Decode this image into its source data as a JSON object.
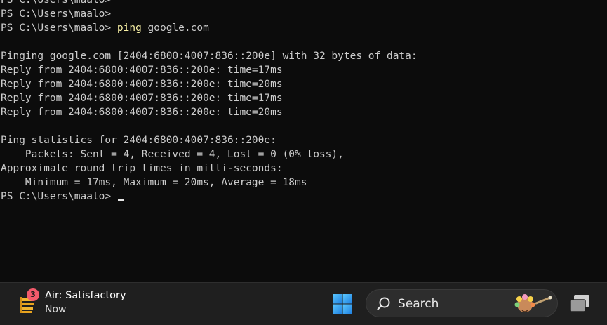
{
  "terminal": {
    "lines": [
      {
        "text": "PS C:\\Users\\maalo>",
        "cmd": ""
      },
      {
        "text": "PS C:\\Users\\maalo>",
        "cmd": ""
      },
      {
        "text": "PS C:\\Users\\maalo> ",
        "cmd": "ping",
        "arg": " google.com"
      },
      {
        "text": "",
        "cmd": ""
      },
      {
        "text": "Pinging google.com [2404:6800:4007:836::200e] with 32 bytes of data:",
        "cmd": ""
      },
      {
        "text": "Reply from 2404:6800:4007:836::200e: time=17ms",
        "cmd": ""
      },
      {
        "text": "Reply from 2404:6800:4007:836::200e: time=20ms",
        "cmd": ""
      },
      {
        "text": "Reply from 2404:6800:4007:836::200e: time=17ms",
        "cmd": ""
      },
      {
        "text": "Reply from 2404:6800:4007:836::200e: time=20ms",
        "cmd": ""
      },
      {
        "text": "",
        "cmd": ""
      },
      {
        "text": "Ping statistics for 2404:6800:4007:836::200e:",
        "cmd": ""
      },
      {
        "text": "    Packets: Sent = 4, Received = 4, Lost = 0 (0% loss),",
        "cmd": ""
      },
      {
        "text": "Approximate round trip times in milli-seconds:",
        "cmd": ""
      },
      {
        "text": "    Minimum = 17ms, Maximum = 20ms, Average = 18ms",
        "cmd": ""
      },
      {
        "text": "PS C:\\Users\\maalo> ",
        "cmd": "",
        "cursor": true
      }
    ]
  },
  "taskbar": {
    "widget": {
      "badge": "3",
      "title": "Air: Satisfactory",
      "subtitle": "Now",
      "icon": "air-quality-icon"
    },
    "start_icon": "windows-logo-icon",
    "search": {
      "label": "Search",
      "icon": "search-icon"
    },
    "taskview_icon": "task-view-icon"
  },
  "colors": {
    "terminal_bg": "#0c0c0c",
    "terminal_fg": "#cccccc",
    "command": "#f9f1a5",
    "taskbar_bg": "#1f1f1f",
    "badge": "#f25a6b",
    "windows_blue": "#2d9cf0"
  }
}
